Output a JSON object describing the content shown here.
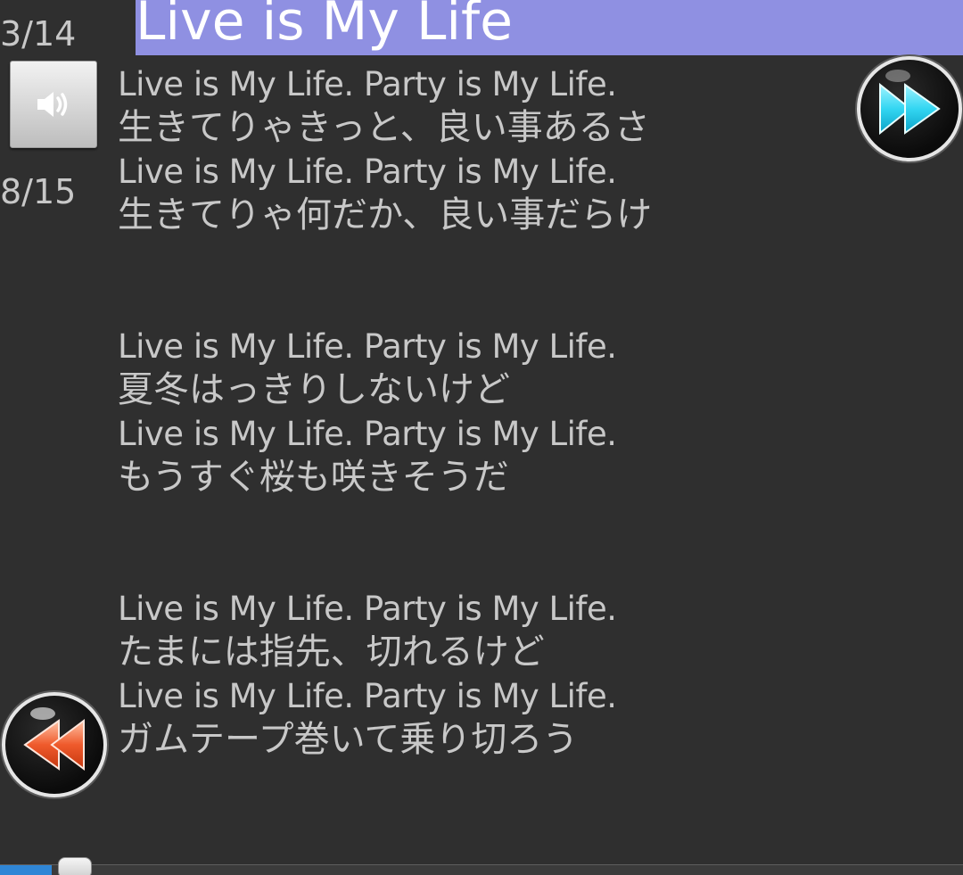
{
  "header": {
    "title": "Live is My Life"
  },
  "counters": {
    "top": "3/14",
    "middle": "8/15"
  },
  "controls": {
    "volume_icon": "speaker-icon",
    "next_icon": "fast-forward-icon",
    "prev_icon": "rewind-icon",
    "next_color": "#33d6f2",
    "prev_color": "#ef5a2c"
  },
  "lyrics": {
    "stanzas": [
      {
        "lines": [
          "Live is My Life. Party is My Life.",
          "生きてりゃきっと、良い事あるさ",
          "Live is My Life. Party is My Life.",
          "生きてりゃ何だか、良い事だらけ"
        ]
      },
      {
        "lines": [
          "Live is My Life. Party is My Life.",
          "夏冬はっきりしないけど",
          "Live is My Life. Party is My Life.",
          "もうすぐ桜も咲きそうだ"
        ]
      },
      {
        "lines": [
          "Live is My Life. Party is My Life.",
          "たまには指先、切れるけど",
          "Live is My Life. Party is My Life.",
          "ガムテープ巻いて乗り切ろう"
        ]
      }
    ]
  },
  "seekbar": {
    "progress": 0.06,
    "accent": "#2f86d6"
  }
}
